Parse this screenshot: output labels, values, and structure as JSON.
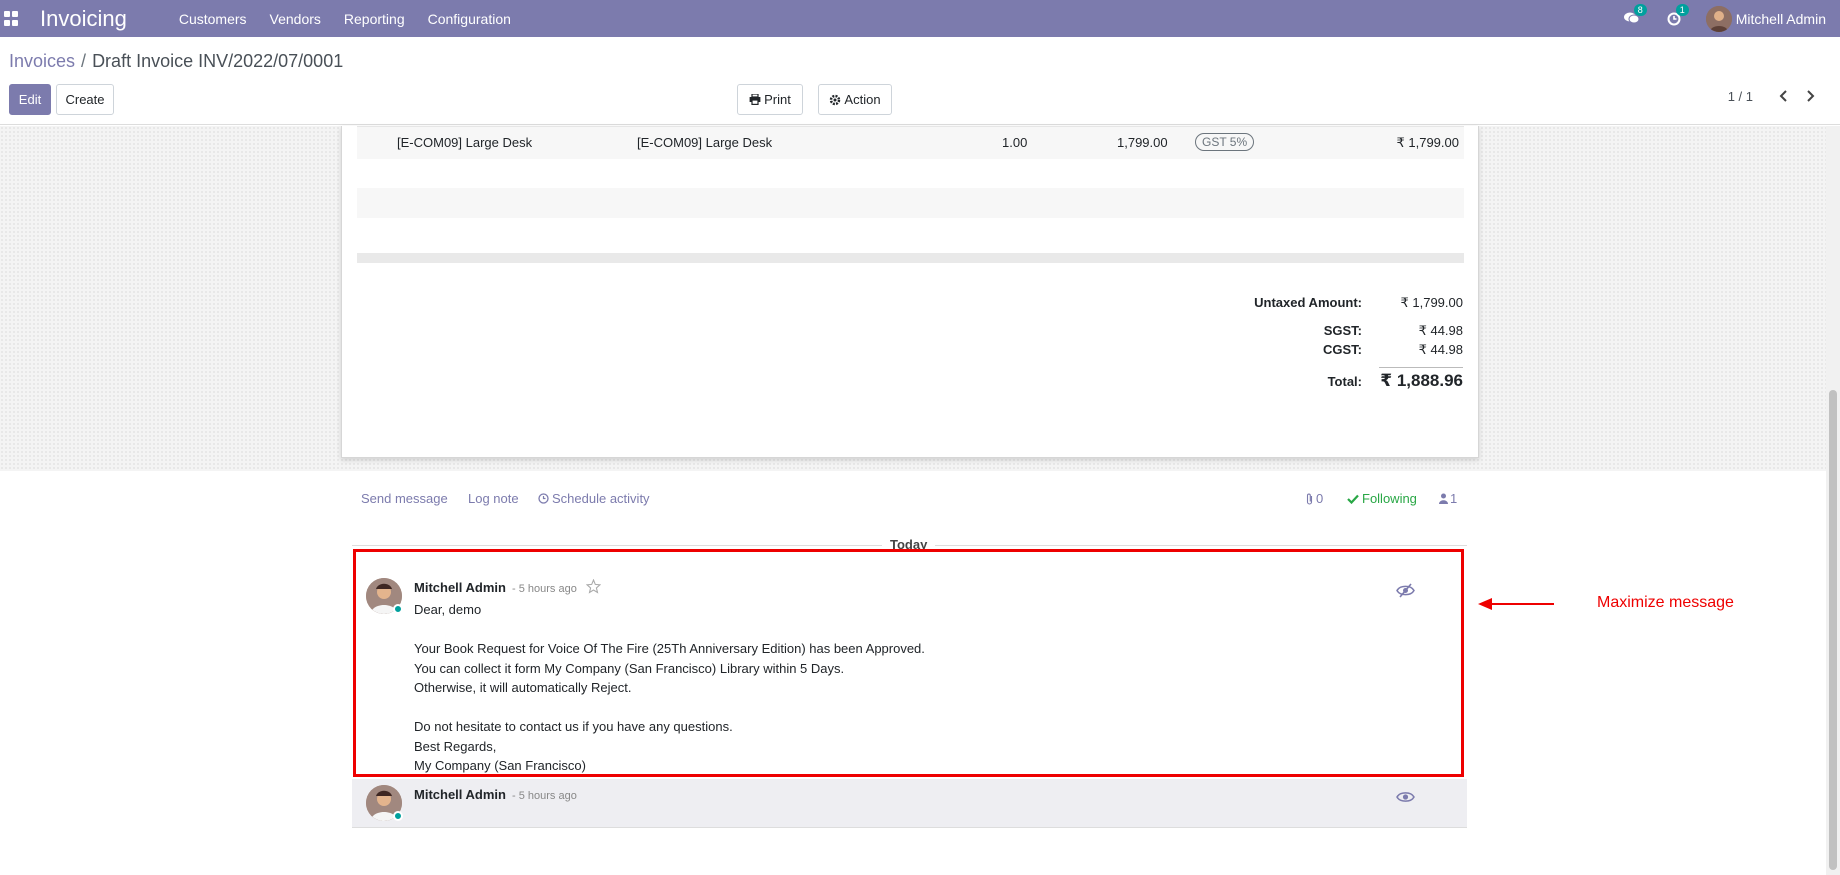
{
  "navbar": {
    "brand": "Invoicing",
    "menu": [
      "Customers",
      "Vendors",
      "Reporting",
      "Configuration"
    ],
    "messages_count": "8",
    "activities_count": "1",
    "user_name": "Mitchell Admin"
  },
  "breadcrumb": {
    "parent": "Invoices",
    "separator": "/",
    "current": "Draft Invoice INV/2022/07/0001"
  },
  "buttons": {
    "edit": "Edit",
    "create": "Create",
    "print": "Print",
    "action": "Action"
  },
  "pager": {
    "value": "1 / 1"
  },
  "invoice_line": {
    "product": "[E-COM09] Large Desk",
    "label": "[E-COM09] Large Desk",
    "quantity": "1.00",
    "price": "1,799.00",
    "tax": "GST 5%",
    "subtotal": "₹ 1,799.00"
  },
  "totals": {
    "untaxed_label": "Untaxed Amount:",
    "untaxed_value": "₹ 1,799.00",
    "sgst_label": "SGST:",
    "sgst_value": "₹ 44.98",
    "cgst_label": "CGST:",
    "cgst_value": "₹ 44.98",
    "total_label": "Total:",
    "total_value": "₹ 1,888.96"
  },
  "chatter": {
    "send_message": "Send message",
    "log_note": "Log note",
    "schedule_activity": "Schedule activity",
    "attachments_count": "0",
    "following": "Following",
    "followers_count": "1",
    "date_separator": "Today"
  },
  "messages": [
    {
      "author": "Mitchell Admin",
      "time": "- 5 hours ago",
      "body": [
        "Dear, demo",
        "",
        "Your Book Request for Voice Of The Fire (25Th Anniversary Edition) has been Approved.",
        "You can collect it form My Company (San Francisco) Library within 5 Days.",
        "Otherwise, it will automatically Reject.",
        "",
        "Do not hesitate to contact us if you have any questions.",
        "Best Regards,",
        "My Company (San Francisco)"
      ]
    },
    {
      "author": "Mitchell Admin",
      "time": "- 5 hours ago"
    }
  ],
  "annotation": {
    "text": "Maximize message"
  },
  "colors": {
    "primary": "#7c7bad",
    "highlight": "#ee0000",
    "teal": "#00a09d"
  }
}
